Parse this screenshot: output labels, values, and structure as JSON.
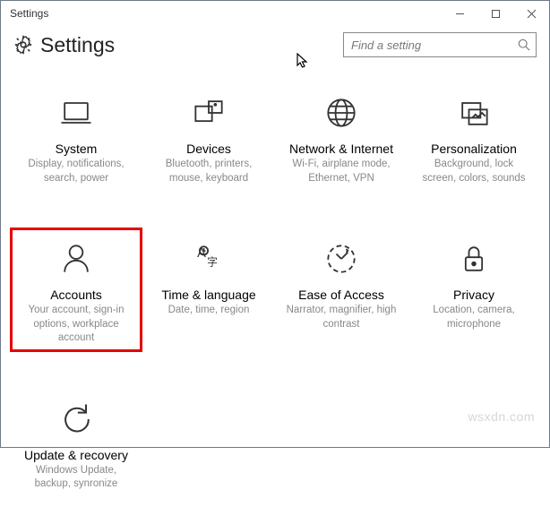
{
  "window": {
    "title": "Settings"
  },
  "header": {
    "title": "Settings"
  },
  "search": {
    "placeholder": "Find a setting"
  },
  "tiles": [
    {
      "title": "System",
      "desc": "Display, notifications, search, power"
    },
    {
      "title": "Devices",
      "desc": "Bluetooth, printers, mouse, keyboard"
    },
    {
      "title": "Network & Internet",
      "desc": "Wi-Fi, airplane mode, Ethernet, VPN"
    },
    {
      "title": "Personalization",
      "desc": "Background, lock screen, colors, sounds"
    },
    {
      "title": "Accounts",
      "desc": "Your account, sign-in options, workplace account"
    },
    {
      "title": "Time & language",
      "desc": "Date, time, region"
    },
    {
      "title": "Ease of Access",
      "desc": "Narrator, magnifier, high contrast"
    },
    {
      "title": "Privacy",
      "desc": "Location, camera, microphone"
    },
    {
      "title": "Update & recovery",
      "desc": "Windows Update, backup, synronize"
    }
  ],
  "watermark": "wsxdn.com"
}
